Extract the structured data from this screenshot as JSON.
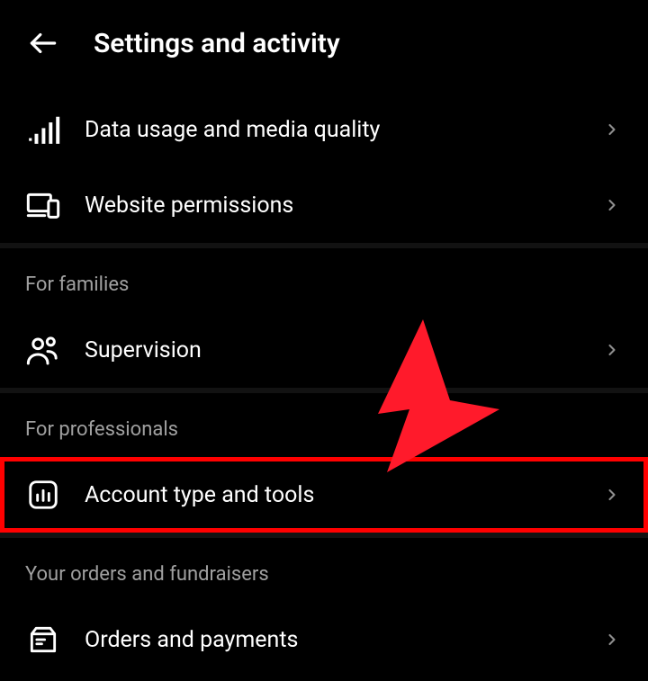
{
  "header": {
    "title": "Settings and activity"
  },
  "top_rows": [
    {
      "icon": "signal-bars-icon",
      "label": "Data usage and media quality"
    },
    {
      "icon": "devices-icon",
      "label": "Website permissions"
    }
  ],
  "sections": [
    {
      "title": "For families",
      "rows": [
        {
          "icon": "people-icon",
          "label": "Supervision",
          "highlighted": false
        }
      ]
    },
    {
      "title": "For professionals",
      "rows": [
        {
          "icon": "chart-box-icon",
          "label": "Account type and tools",
          "highlighted": true
        }
      ]
    },
    {
      "title": "Your orders and fundraisers",
      "rows": [
        {
          "icon": "orders-icon",
          "label": "Orders and payments",
          "highlighted": false
        }
      ]
    }
  ],
  "annotation": {
    "type": "arrow",
    "color": "#ff1a2b",
    "target": "account-type-and-tools"
  }
}
